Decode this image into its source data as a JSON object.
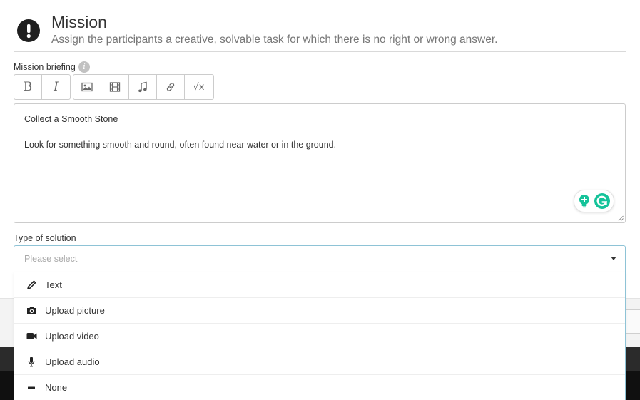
{
  "header": {
    "title": "Mission",
    "subtitle": "Assign the participants a creative, solvable task for which there is no right or wrong answer.",
    "icon": "exclamation-circle-icon"
  },
  "briefing": {
    "label": "Mission briefing",
    "info_icon_glyph": "i",
    "toolbar": {
      "bold_label": "B",
      "italic_label": "I",
      "formula_label": "√x",
      "icons": [
        "image-icon",
        "film-icon",
        "music-icon",
        "link-icon",
        "formula-icon"
      ]
    },
    "content": {
      "line1": "Collect a Smooth Stone",
      "line2": "Look for something smooth and round, often found near water or in the ground."
    }
  },
  "solution": {
    "label": "Type of solution",
    "placeholder": "Please select",
    "options": [
      {
        "label": "Text",
        "icon": "pencil-icon"
      },
      {
        "label": "Upload picture",
        "icon": "camera-icon"
      },
      {
        "label": "Upload video",
        "icon": "video-camera-icon"
      },
      {
        "label": "Upload audio",
        "icon": "microphone-icon"
      },
      {
        "label": "None",
        "icon": "minus-icon"
      }
    ]
  },
  "colors": {
    "accent_border": "#8ec3d6",
    "grammarly_green": "#15c39a",
    "dark_footer": "#2b2b2b"
  }
}
